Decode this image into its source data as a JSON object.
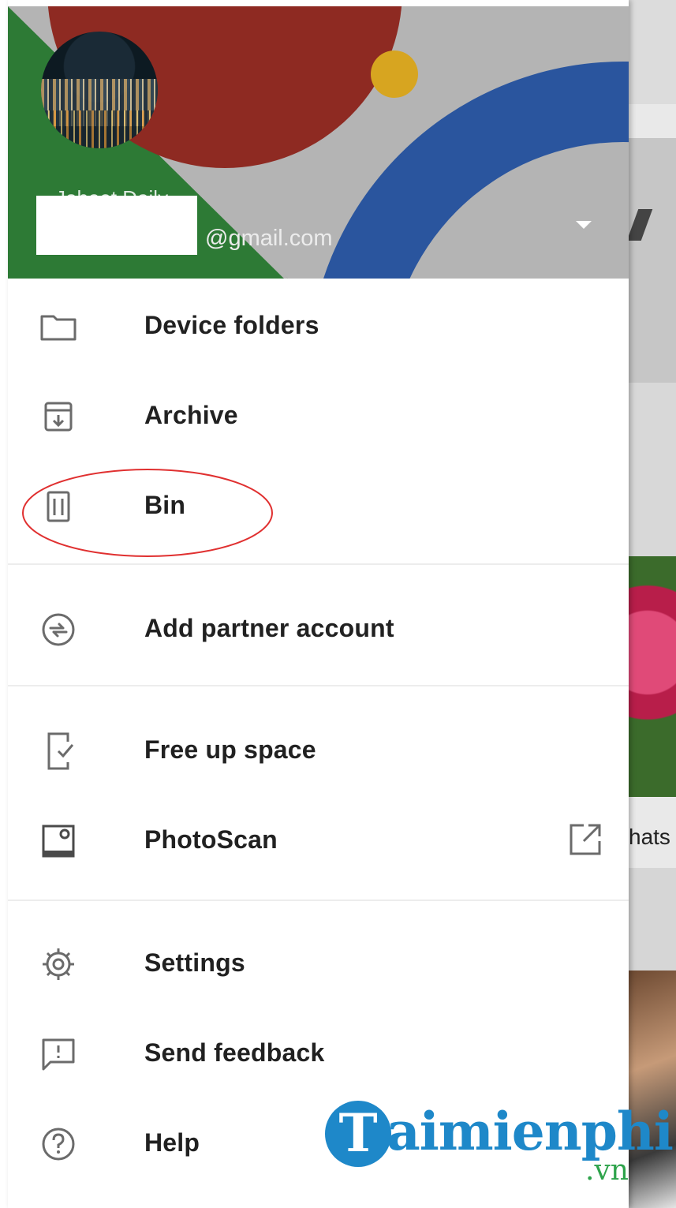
{
  "account": {
    "name": "Joheet Daily",
    "email": "@gmail.com"
  },
  "menu": {
    "device_folders": "Device folders",
    "archive": "Archive",
    "bin": "Bin",
    "add_partner_account": "Add partner account",
    "free_up_space": "Free up space",
    "photoscan": "PhotoScan",
    "settings": "Settings",
    "send_feedback": "Send feedback",
    "help": "Help"
  },
  "background_app": {
    "partial_text": "hats"
  },
  "watermark": {
    "logo_letter": "T",
    "brand": "aimienphi",
    "tld": ".vn"
  },
  "colors": {
    "header_red": "#8e2a22",
    "header_blue": "#2a559e",
    "header_green": "#2d7a35",
    "header_yellow": "#d7a520",
    "header_gray": "#b4b4b4",
    "highlight_circle": "#e03030",
    "icon_gray": "#6b6b6b",
    "text": "#212121",
    "watermark_blue": "#1e88c9",
    "watermark_green": "#2ea34b"
  },
  "icons": {
    "device_folders": "folder-icon",
    "archive": "archive-icon",
    "bin": "trash-icon",
    "add_partner_account": "partner-share-icon",
    "free_up_space": "phone-check-icon",
    "photoscan": "photoscan-icon",
    "settings": "gear-icon",
    "send_feedback": "feedback-icon",
    "help": "help-icon",
    "external": "open-external-icon",
    "dropdown": "caret-down-icon"
  }
}
